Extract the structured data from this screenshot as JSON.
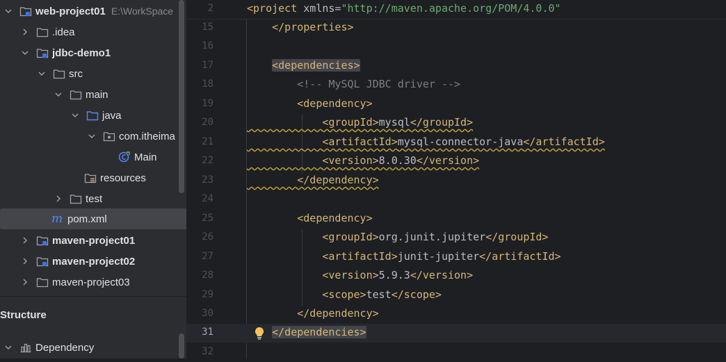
{
  "project_tree": {
    "root": {
      "name": "web-project01",
      "path": "E:\\WorkSpace"
    },
    "items": [
      {
        "label": "web-project01",
        "path": "E:\\WorkSpace"
      },
      {
        "label": ".idea"
      },
      {
        "label": "jdbc-demo1"
      },
      {
        "label": "src"
      },
      {
        "label": "main"
      },
      {
        "label": "java"
      },
      {
        "label": "com.itheima"
      },
      {
        "label": "Main"
      },
      {
        "label": "resources"
      },
      {
        "label": "test"
      },
      {
        "label": "pom.xml"
      },
      {
        "label": "maven-project01"
      },
      {
        "label": "maven-project02"
      },
      {
        "label": "maven-project03"
      }
    ]
  },
  "structure": {
    "title": "Structure",
    "items": [
      {
        "label": "Dependency"
      }
    ]
  },
  "editor": {
    "file": "pom.xml",
    "current_line": 31,
    "sticky": {
      "num": "2",
      "pre": "<project ",
      "attr": "xmlns=",
      "value": "\"http://maven.apache.org/POM/4.0.0\""
    },
    "lines": [
      {
        "num": "15",
        "text": "    </properties>"
      },
      {
        "num": "16",
        "text": ""
      },
      {
        "num": "17",
        "text": "    <dependencies>"
      },
      {
        "num": "18",
        "text": "        <!-- MySQL JDBC driver -->"
      },
      {
        "num": "19",
        "text": "        <dependency>"
      },
      {
        "num": "20",
        "open": "<groupId>",
        "value": "mysql",
        "close": "</groupId>"
      },
      {
        "num": "21",
        "open": "<artifactId>",
        "value": "mysql-connector-java",
        "close": "</artifactId>"
      },
      {
        "num": "22",
        "open": "<version>",
        "value": "8.0.30",
        "close": "</version>"
      },
      {
        "num": "23",
        "text": "        </dependency>"
      },
      {
        "num": "24",
        "text": ""
      },
      {
        "num": "25",
        "text": "        <dependency>"
      },
      {
        "num": "26",
        "open": "<groupId>",
        "value": "org.junit.jupiter",
        "close": "</groupId>"
      },
      {
        "num": "27",
        "open": "<artifactId>",
        "value": "junit-jupiter",
        "close": "</artifactId>"
      },
      {
        "num": "28",
        "open": "<version>",
        "value": "5.9.3",
        "close": "</version>"
      },
      {
        "num": "29",
        "open": "<scope>",
        "value": "test",
        "close": "</scope>"
      },
      {
        "num": "30",
        "text": "        </dependency>"
      },
      {
        "num": "31",
        "text": "    </dependencies>"
      },
      {
        "num": "32",
        "text": ""
      }
    ]
  },
  "colors": {
    "tag": "#d5b778",
    "text": "#bcbec4",
    "comment": "#7a7e85",
    "string": "#6aab73",
    "folder_icon": "#a1a3ab",
    "source_folder_icon": "#548af7",
    "warning_underline": "#b8a23a"
  }
}
